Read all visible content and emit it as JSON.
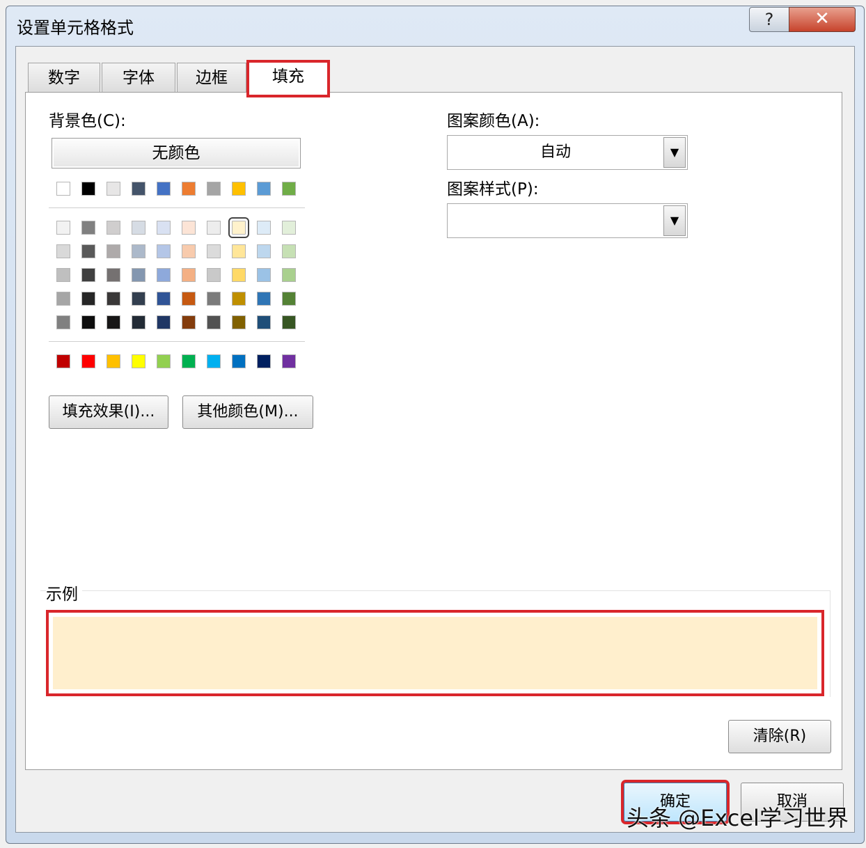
{
  "dialog": {
    "title": "设置单元格格式",
    "help_icon": "?",
    "close_icon": "✕"
  },
  "tabs": [
    {
      "label": "数字"
    },
    {
      "label": "字体"
    },
    {
      "label": "边框"
    },
    {
      "label": "填充",
      "active": true
    }
  ],
  "fill": {
    "bg_color_label": "背景色(C):",
    "no_color_button": "无颜色",
    "theme_row": [
      "#ffffff",
      "#000000",
      "#e7e6e6",
      "#44546a",
      "#4472c4",
      "#ed7d31",
      "#a5a5a5",
      "#ffc000",
      "#5b9bd5",
      "#70ad47"
    ],
    "tint_rows": [
      [
        "#f2f2f2",
        "#808080",
        "#d0cece",
        "#d6dce4",
        "#d9e1f2",
        "#fce4d6",
        "#ededed",
        "#fff2cc",
        "#ddebf7",
        "#e2efda"
      ],
      [
        "#d9d9d9",
        "#595959",
        "#aeaaaa",
        "#acb9ca",
        "#b4c6e7",
        "#f8cbad",
        "#dbdbdb",
        "#ffe699",
        "#bdd7ee",
        "#c6e0b4"
      ],
      [
        "#bfbfbf",
        "#404040",
        "#757171",
        "#8497b0",
        "#8ea9db",
        "#f4b084",
        "#c9c9c9",
        "#ffd966",
        "#9bc2e6",
        "#a9d08e"
      ],
      [
        "#a6a6a6",
        "#262626",
        "#3a3838",
        "#333f4f",
        "#305496",
        "#c65911",
        "#7b7b7b",
        "#bf8f00",
        "#2f75b5",
        "#548235"
      ],
      [
        "#808080",
        "#0d0d0d",
        "#171616",
        "#222b35",
        "#203764",
        "#833c0c",
        "#525252",
        "#806000",
        "#1f4e78",
        "#375623"
      ]
    ],
    "standard_row": [
      "#c00000",
      "#ff0000",
      "#ffc000",
      "#ffff00",
      "#92d050",
      "#00b050",
      "#00b0f0",
      "#0070c0",
      "#002060",
      "#7030a0"
    ],
    "selected_color": "#fff2cc",
    "fill_effects_button": "填充效果(I)...",
    "more_colors_button": "其他颜色(M)...",
    "pattern_color_label": "图案颜色(A):",
    "pattern_color_value": "自动",
    "pattern_style_label": "图案样式(P):",
    "pattern_style_value": "",
    "sample_label": "示例",
    "sample_color": "#ffefcd",
    "clear_button": "清除(R)"
  },
  "footer": {
    "ok_button": "确定",
    "cancel_button": "取消"
  },
  "watermark": "头条 @Excel学习世界"
}
